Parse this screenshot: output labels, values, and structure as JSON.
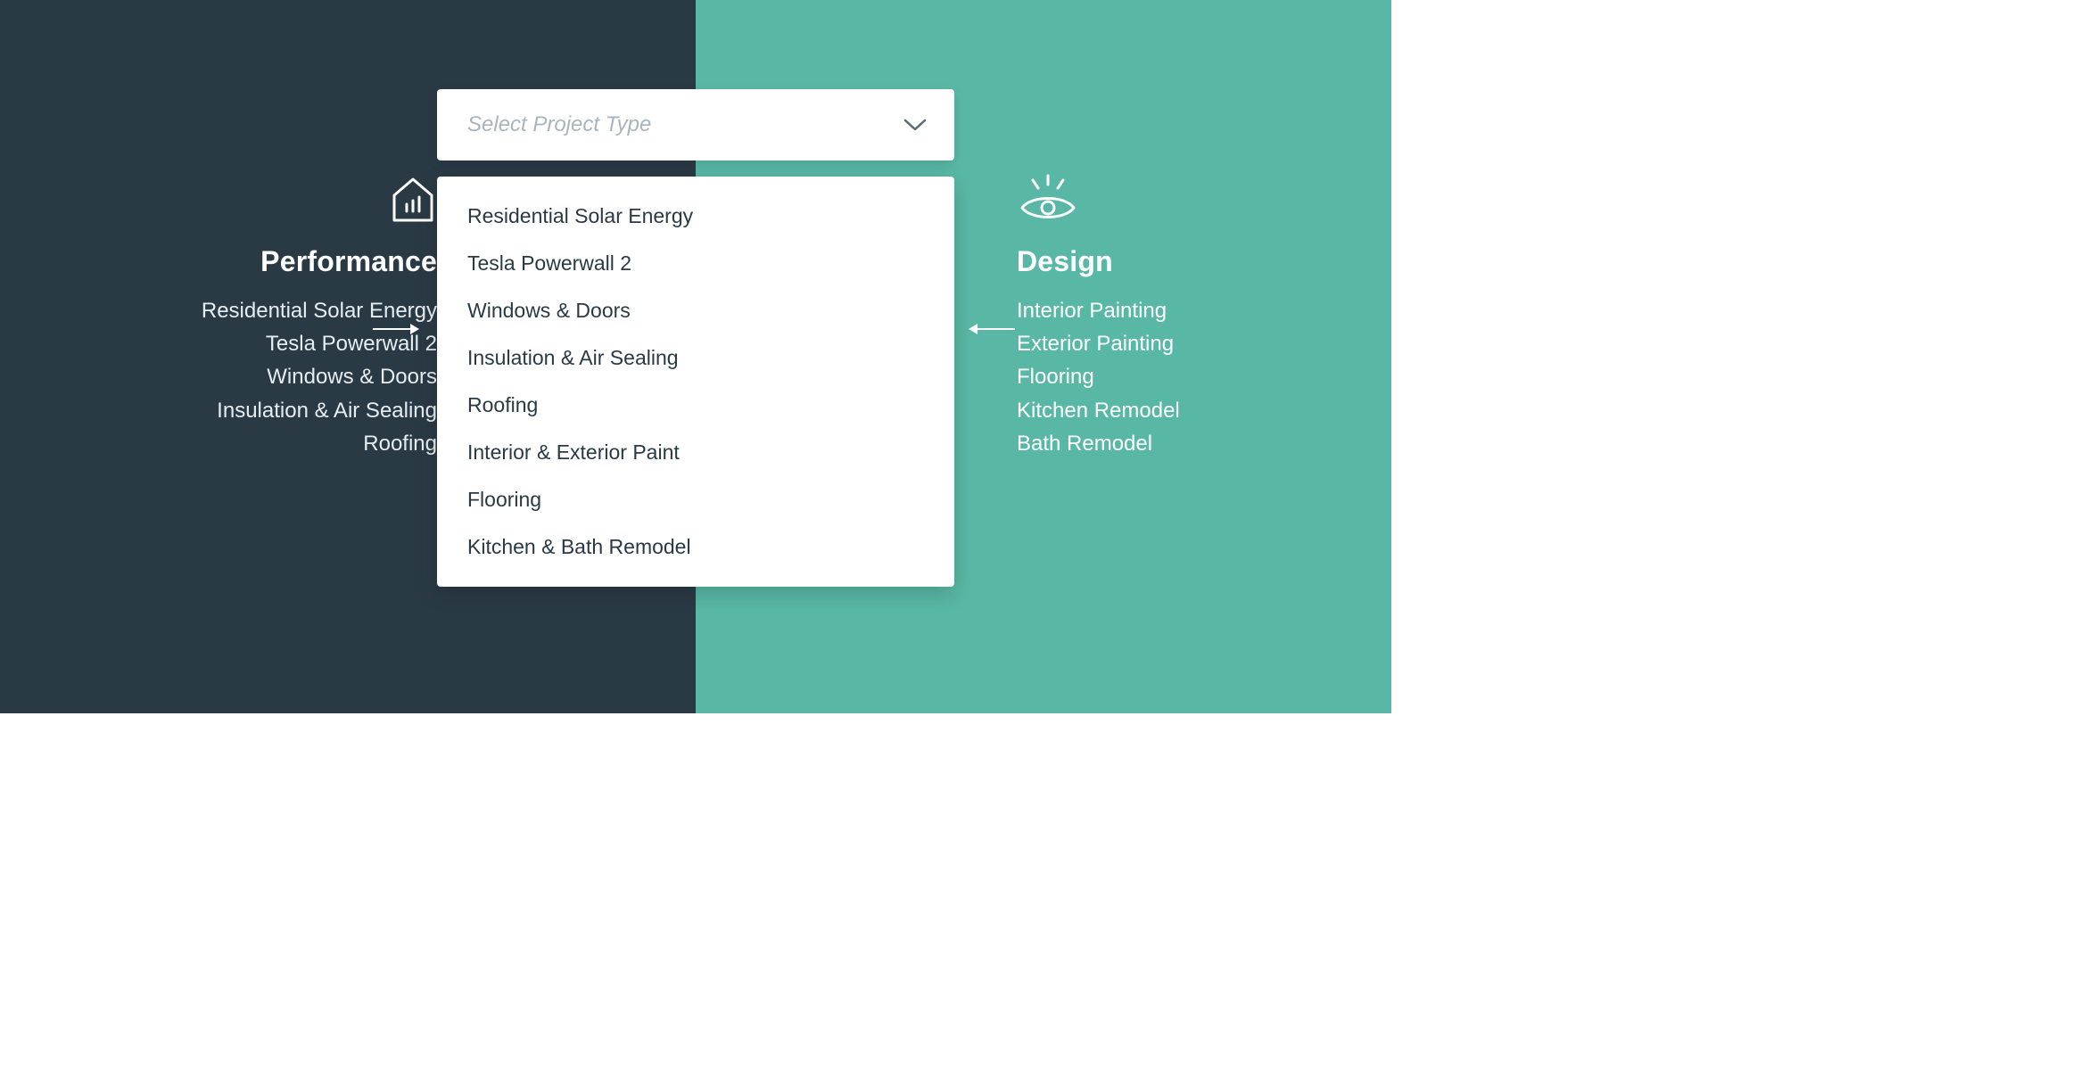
{
  "left": {
    "title": "Performance",
    "items": [
      "Residential Solar Energy",
      "Tesla Powerwall 2",
      "Windows & Doors",
      "Insulation & Air Sealing",
      "Roofing"
    ]
  },
  "right": {
    "title": "Design",
    "items": [
      "Interior Painting",
      "Exterior Painting",
      "Flooring",
      "Kitchen Remodel",
      "Bath Remodel"
    ]
  },
  "dropdown": {
    "placeholder": "Select Project Type",
    "options": [
      "Residential Solar Energy",
      "Tesla Powerwall 2",
      "Windows & Doors",
      "Insulation & Air Sealing",
      "Roofing",
      "Interior & Exterior Paint",
      "Flooring",
      "Kitchen & Bath Remodel"
    ]
  },
  "colors": {
    "left": "#2a3a45",
    "right": "#59b8a5",
    "placeholder": "#a9b5bd",
    "text": "#2a3a45"
  }
}
